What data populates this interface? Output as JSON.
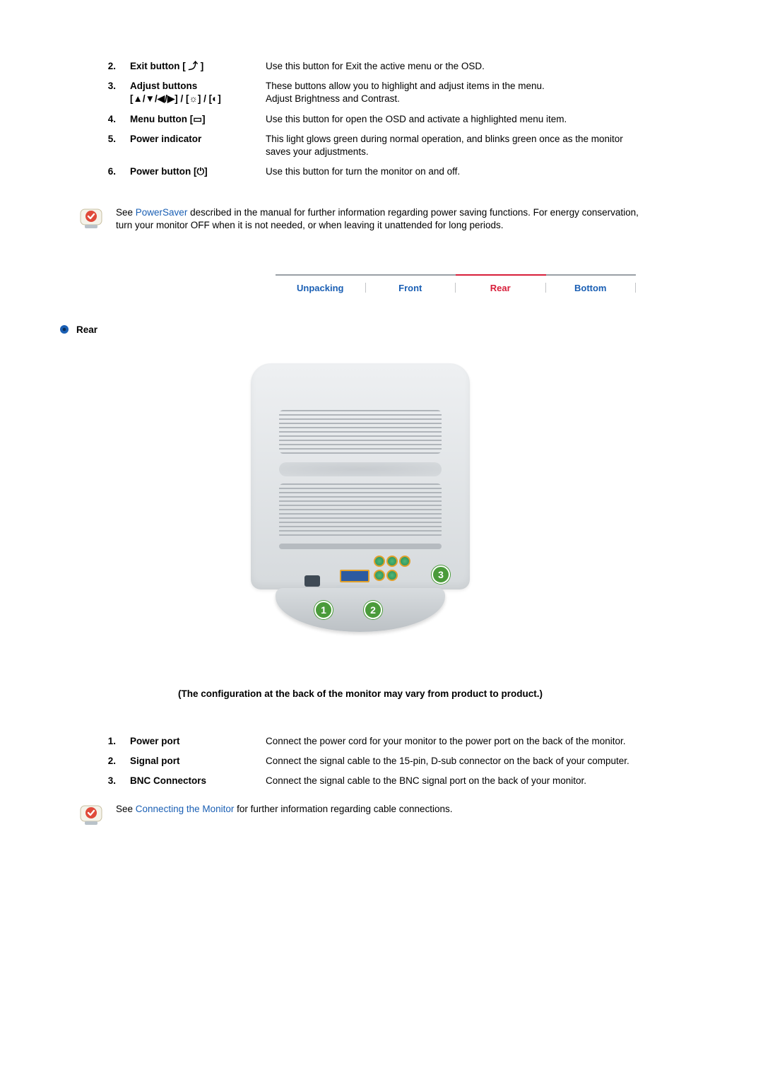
{
  "front_items": [
    {
      "num": "2.",
      "term": "Exit button [ ⤴ ]",
      "desc": "Use this button for Exit the active menu or the OSD."
    },
    {
      "num": "3.",
      "term": "Adjust buttons\n[▲/▼/◀/▶] / [☼] / [◐]",
      "desc": "These buttons allow you to highlight and adjust items in the menu.\nAdjust Brightness and Contrast."
    },
    {
      "num": "4.",
      "term": "Menu button [▭]",
      "desc": "Use this button for open the OSD and activate a highlighted menu item."
    },
    {
      "num": "5.",
      "term": "Power indicator",
      "desc": "This light glows green during normal operation, and blinks green once as the monitor saves your adjustments."
    },
    {
      "num": "6.",
      "term": "Power button [⏻]",
      "desc": "Use this button for turn the monitor on and off."
    }
  ],
  "note1_pre": "See ",
  "note1_link": "PowerSaver",
  "note1_post": " described in the manual for further information regarding power saving functions. For energy conservation, turn your monitor OFF when it is not needed, or when leaving it unattended for long periods.",
  "tabs": {
    "items": [
      "Unpacking",
      "Front",
      "Rear",
      "Bottom"
    ],
    "active_index": 2,
    "active_color": "#d81e3a",
    "inactive_color": "#9aa0a6"
  },
  "section_title": "Rear",
  "callouts": [
    "1",
    "2",
    "3"
  ],
  "figure_note": "(The configuration at the back of the monitor may vary from product to product.)",
  "rear_items": [
    {
      "num": "1.",
      "term": "Power port",
      "desc": "Connect the power cord for your monitor to the power port on the back of the monitor."
    },
    {
      "num": "2.",
      "term": "Signal port",
      "desc": "Connect the signal cable to the 15-pin, D-sub connector on the back of your computer."
    },
    {
      "num": "3.",
      "term": "BNC Connectors",
      "desc": "Connect the signal cable to the BNC signal port on the back of your monitor."
    }
  ],
  "note2_pre": "See ",
  "note2_link": "Connecting the Monitor",
  "note2_post": " for further information regarding cable connections."
}
